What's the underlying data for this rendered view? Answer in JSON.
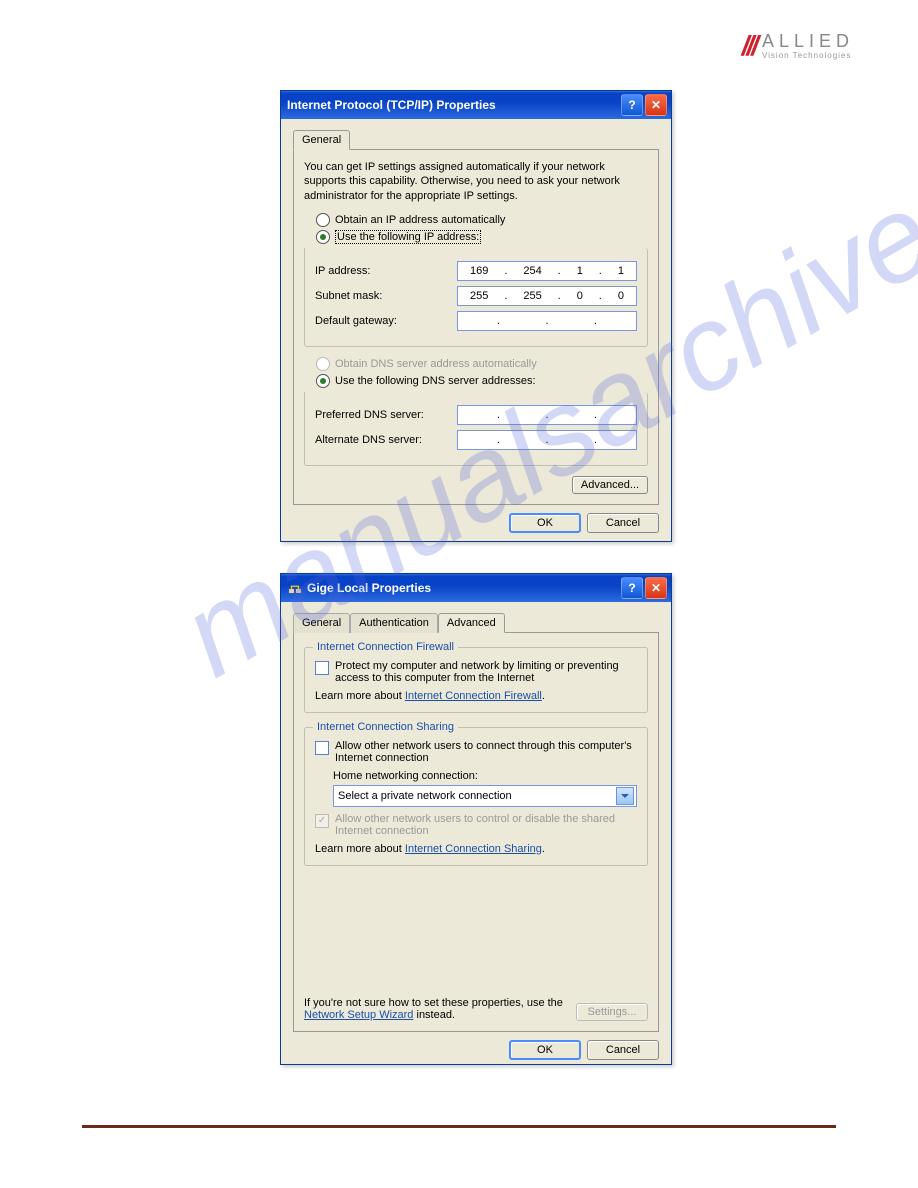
{
  "logo": {
    "brand": "ALLIED",
    "tagline": "Vision Technologies"
  },
  "watermark": "manualsarchive.com",
  "dialog1": {
    "title": "Internet Protocol (TCP/IP) Properties",
    "tabs": {
      "general": "General"
    },
    "description": "You can get IP settings assigned automatically if your network supports this capability. Otherwise, you need to ask your network administrator for the appropriate IP settings.",
    "radio_obtain_ip": "Obtain an IP address automatically",
    "radio_use_ip": "Use the following IP address:",
    "labels": {
      "ip_address": "IP address:",
      "subnet_mask": "Subnet mask:",
      "default_gateway": "Default gateway:"
    },
    "values": {
      "ip": [
        "169",
        "254",
        "1",
        "1"
      ],
      "subnet": [
        "255",
        "255",
        "0",
        "0"
      ],
      "gateway": [
        "",
        "",
        "",
        ""
      ]
    },
    "radio_obtain_dns": "Obtain DNS server address automatically",
    "radio_use_dns": "Use the following DNS server addresses:",
    "dns_labels": {
      "preferred": "Preferred DNS server:",
      "alternate": "Alternate DNS server:"
    },
    "dns_values": {
      "preferred": [
        "",
        "",
        "",
        ""
      ],
      "alternate": [
        "",
        "",
        "",
        ""
      ]
    },
    "buttons": {
      "advanced": "Advanced...",
      "ok": "OK",
      "cancel": "Cancel"
    }
  },
  "dialog2": {
    "title": "Gige Local Properties",
    "tabs": {
      "general": "General",
      "authentication": "Authentication",
      "advanced": "Advanced"
    },
    "firewall_group": "Internet Connection Firewall",
    "firewall_checkbox": "Protect my computer and network by limiting or preventing access to this computer from the Internet",
    "learn_more_prefix": "Learn more about ",
    "firewall_link": "Internet Connection Firewall",
    "sharing_group": "Internet Connection Sharing",
    "sharing_checkbox": "Allow other network users to connect through this computer's Internet connection",
    "home_net_label": "Home networking connection:",
    "home_net_value": "Select a private network connection",
    "control_checkbox": "Allow other network users to control or disable the shared Internet connection",
    "sharing_link": "Internet Connection Sharing",
    "footer_text_prefix": "If you're not sure how to set these properties, use the ",
    "wizard_link": "Network Setup Wizard",
    "footer_text_suffix": " instead.",
    "buttons": {
      "settings": "Settings...",
      "ok": "OK",
      "cancel": "Cancel"
    },
    "period": "."
  }
}
